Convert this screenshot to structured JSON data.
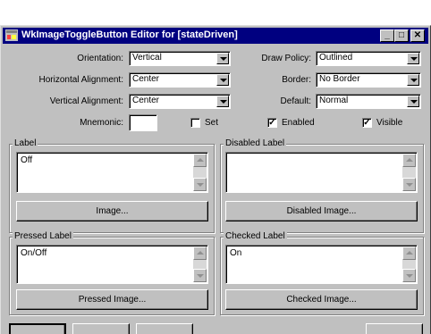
{
  "window": {
    "title": "WkImageToggleButton Editor for [stateDriven]",
    "controls": {
      "minimize": "_",
      "maximize": "□",
      "close": "✕"
    },
    "title_bg": "#000080"
  },
  "fields": {
    "orientation": {
      "label": "Orientation:",
      "value": "Vertical"
    },
    "horizontal_alignment": {
      "label": "Horizontal Alignment:",
      "value": "Center"
    },
    "vertical_alignment": {
      "label": "Vertical Alignment:",
      "value": "Center"
    },
    "draw_policy": {
      "label": "Draw Policy:",
      "value": "Outlined"
    },
    "border": {
      "label": "Border:",
      "value": "No Border"
    },
    "default": {
      "label": "Default:",
      "value": "Normal"
    },
    "mnemonic": {
      "label": "Mnemonic:",
      "value": ""
    }
  },
  "checkboxes": {
    "set": {
      "label": "Set",
      "checked": false
    },
    "enabled": {
      "label": "Enabled",
      "checked": true
    },
    "visible": {
      "label": "Visible",
      "checked": true
    }
  },
  "groups": {
    "label": {
      "title": "Label",
      "text": "Off",
      "button": "Image..."
    },
    "disabled_label": {
      "title": "Disabled Label",
      "text": "",
      "button": "Disabled Image..."
    },
    "pressed_label": {
      "title": "Pressed Label",
      "text": "On/Off",
      "button": "Pressed Image..."
    },
    "checked_label": {
      "title": "Checked Label",
      "text": "On",
      "button": "Checked Image..."
    }
  },
  "icons": [
    "window-app-icon",
    "minimize-icon",
    "maximize-icon",
    "close-icon",
    "combo-arrow-icon",
    "scroll-up-icon",
    "scroll-down-icon",
    "checkmark-icon"
  ]
}
